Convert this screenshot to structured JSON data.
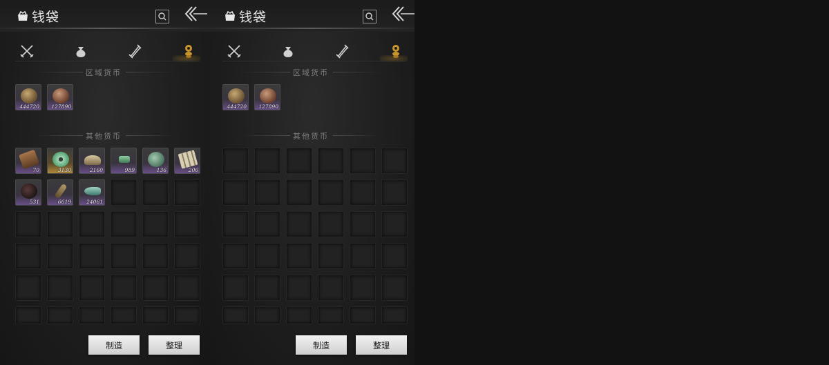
{
  "panels": [
    {
      "title": "钱袋",
      "tabs": [
        {
          "icon": "crossed-swords-icon",
          "active": false
        },
        {
          "icon": "pouch-icon",
          "active": false
        },
        {
          "icon": "scroll-icon",
          "active": false
        },
        {
          "icon": "coin-stack-icon",
          "active": true
        }
      ],
      "regional_label": "区域货币",
      "regional_items": [
        {
          "icon": "bronze-coin-icon",
          "count": "444720"
        },
        {
          "icon": "copper-coin-icon",
          "count": "127890"
        }
      ],
      "other_label": "其他货币",
      "other_items": [
        {
          "icon": "bark-token-icon",
          "count": "70",
          "rarity": "purple"
        },
        {
          "icon": "jade-disc-icon",
          "count": "3130",
          "rarity": "gold"
        },
        {
          "icon": "silver-ingot-icon",
          "count": "2160",
          "rarity": "purple"
        },
        {
          "icon": "jade-fragment-icon",
          "count": "989",
          "rarity": "purple"
        },
        {
          "icon": "jade-stone-icon",
          "count": "136",
          "rarity": "purple"
        },
        {
          "icon": "bamboo-slips-icon",
          "count": "206",
          "rarity": "purple"
        },
        {
          "icon": "dark-relic-icon",
          "count": "531",
          "rarity": "purple"
        },
        {
          "icon": "bronze-key-icon",
          "count": "6619",
          "rarity": "purple"
        },
        {
          "icon": "jade-fish-icon",
          "count": "24061",
          "rarity": "purple"
        }
      ],
      "buttons": {
        "craft": "制造",
        "sort": "整理"
      }
    },
    {
      "title": "钱袋",
      "tabs": [
        {
          "icon": "crossed-swords-icon",
          "active": false
        },
        {
          "icon": "pouch-icon",
          "active": false
        },
        {
          "icon": "scroll-icon",
          "active": false
        },
        {
          "icon": "coin-stack-icon",
          "active": true
        }
      ],
      "regional_label": "区域货币",
      "regional_items": [
        {
          "icon": "bronze-coin-icon",
          "count": "444720"
        },
        {
          "icon": "copper-coin-icon",
          "count": "127890"
        }
      ],
      "other_label": "其他货币",
      "other_items": [],
      "buttons": {
        "craft": "制造",
        "sort": "整理"
      }
    }
  ],
  "colors": {
    "accent_gold": "#c9962e",
    "rarity_purple": "#6a4f8a",
    "rarity_gold": "#b08a3a"
  }
}
